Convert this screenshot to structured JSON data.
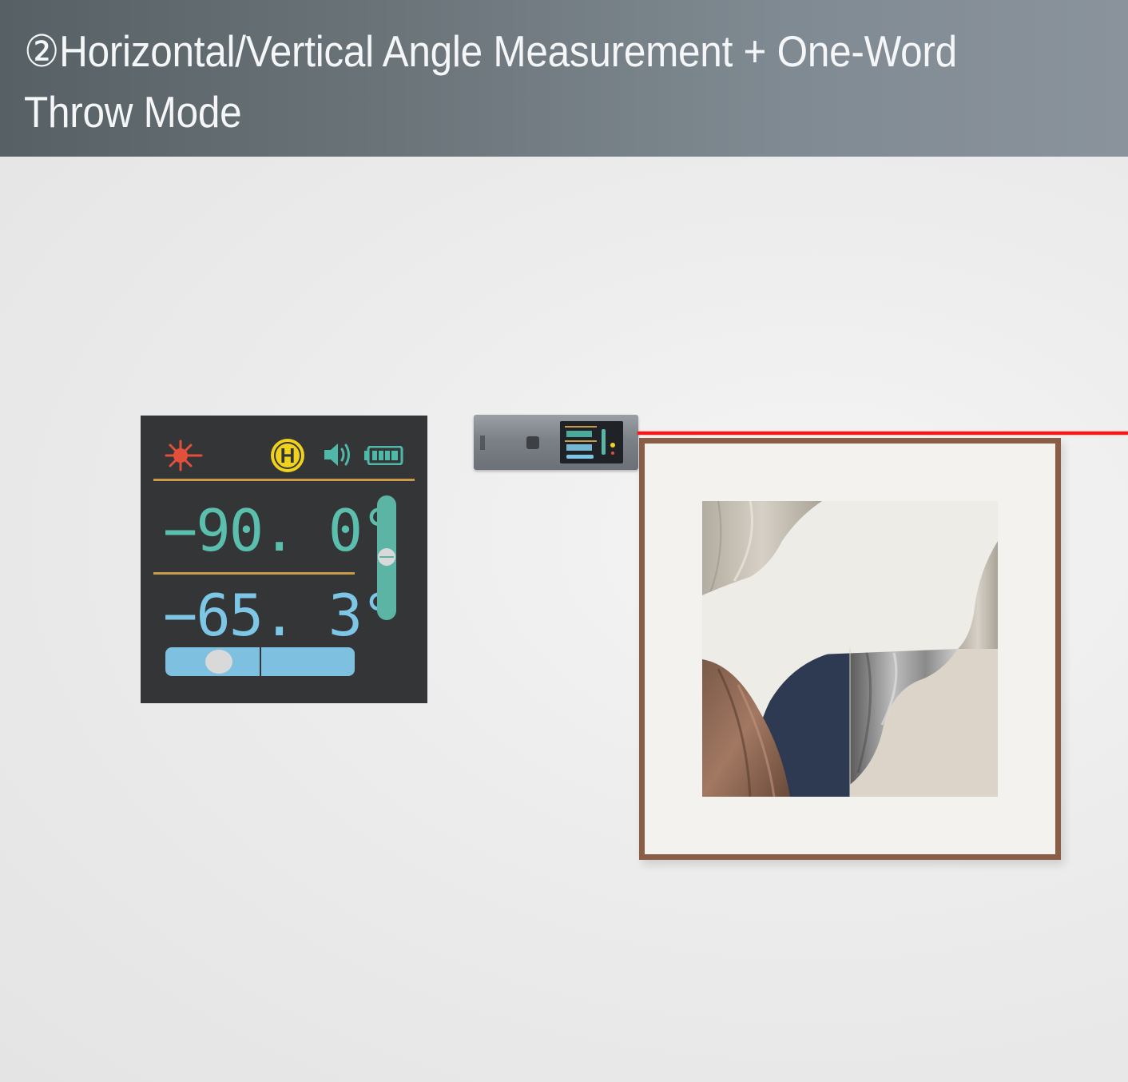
{
  "banner": {
    "title": "②Horizontal/Vertical Angle Measurement + One-Word Throw Mode"
  },
  "lcd": {
    "mode_badge": "H",
    "vertical_reading": "−90. 0°",
    "horizontal_reading": "−65. 3°",
    "icons": [
      "laser-icon",
      "horizontal-mode-icon",
      "speaker-icon",
      "battery-icon"
    ],
    "battery_level": 1.0,
    "vertical_level_indicator": 0.5,
    "horizontal_level_indicator": 0.28
  },
  "colors": {
    "vertical_reading": "#5bbfae",
    "horizontal_reading": "#7ec6e6",
    "laser_beam": "#f01818",
    "lcd_background": "#343536",
    "badge": "#f0d21e",
    "divider": "#c89a4a"
  }
}
